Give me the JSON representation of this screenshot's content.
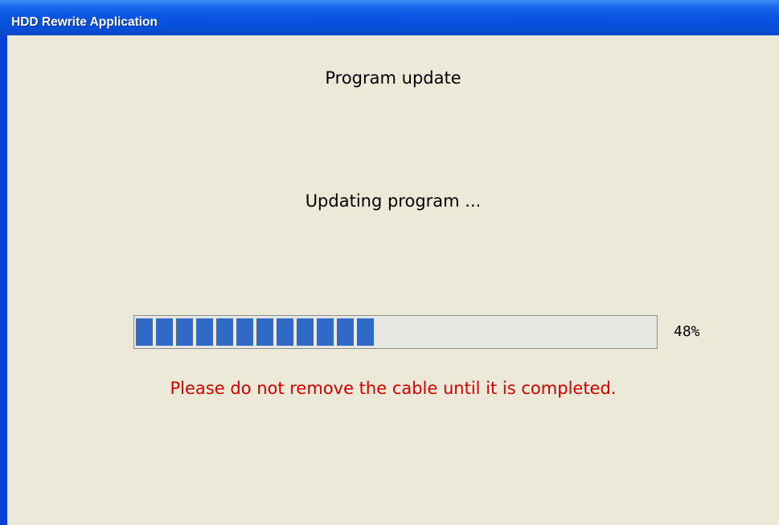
{
  "window": {
    "title": "HDD Rewrite Application"
  },
  "dialog": {
    "heading": "Program update",
    "status": "Updating program ...",
    "progress": {
      "percent_value": 48,
      "percent_label": "48%"
    },
    "warning": "Please do not remove the cable until it is completed."
  },
  "colors": {
    "titlebar": "#0A55E4",
    "dialog_background": "#ECE9D8",
    "progress_fill": "#3169C6",
    "warning_text": "#D40000"
  }
}
